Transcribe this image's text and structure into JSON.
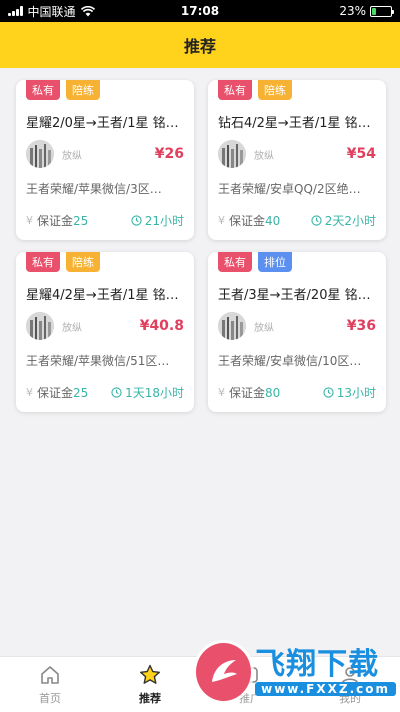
{
  "status_bar": {
    "carrier": "中国联通",
    "time": "17:08",
    "battery": "23%",
    "battery_level": 0.23
  },
  "header": {
    "title": "推荐"
  },
  "cards": [
    {
      "tags": [
        {
          "label": "私有",
          "type": "private"
        },
        {
          "label": "陪练",
          "type": "play"
        }
      ],
      "title": "星耀2/0星→王者/1星 铭…",
      "username": "放纵",
      "price": "¥26",
      "desc": "王者荣耀/苹果微信/3区…",
      "deposit_label": "保证金",
      "deposit_value": "25",
      "time": "21小时"
    },
    {
      "tags": [
        {
          "label": "私有",
          "type": "private"
        },
        {
          "label": "陪练",
          "type": "play"
        }
      ],
      "title": "钻石4/2星→王者/1星 铭…",
      "username": "放纵",
      "price": "¥54",
      "desc": "王者荣耀/安卓QQ/2区绝…",
      "deposit_label": "保证金",
      "deposit_value": "40",
      "time": "2天2小时"
    },
    {
      "tags": [
        {
          "label": "私有",
          "type": "private"
        },
        {
          "label": "陪练",
          "type": "play"
        }
      ],
      "title": "星耀4/2星→王者/1星 铭…",
      "username": "放纵",
      "price": "¥40.8",
      "desc": "王者荣耀/苹果微信/51区…",
      "deposit_label": "保证金",
      "deposit_value": "25",
      "time": "1天18小时"
    },
    {
      "tags": [
        {
          "label": "私有",
          "type": "private"
        },
        {
          "label": "排位",
          "type": "rank"
        }
      ],
      "title": "王者/3星→王者/20星 铭…",
      "username": "放纵",
      "price": "¥36",
      "desc": "王者荣耀/安卓微信/10区…",
      "deposit_label": "保证金",
      "deposit_value": "80",
      "time": "13小时"
    }
  ],
  "tabbar": {
    "tabs": [
      {
        "label": "首页",
        "icon": "home-icon",
        "active": false
      },
      {
        "label": "推荐",
        "icon": "star-icon",
        "active": true
      },
      {
        "label": "推广",
        "icon": "promote-icon",
        "active": false
      },
      {
        "label": "我的",
        "icon": "profile-icon",
        "active": false
      }
    ]
  },
  "watermark": {
    "title": "飞翔下载",
    "url": "www.FXXZ.com"
  },
  "colors": {
    "header_bg": "#ffd21c",
    "price": "#e0405e",
    "accent_teal": "#39b5a7",
    "tag_private": "#e9506b",
    "tag_play": "#f7b233",
    "tag_rank": "#5b8ff0"
  }
}
